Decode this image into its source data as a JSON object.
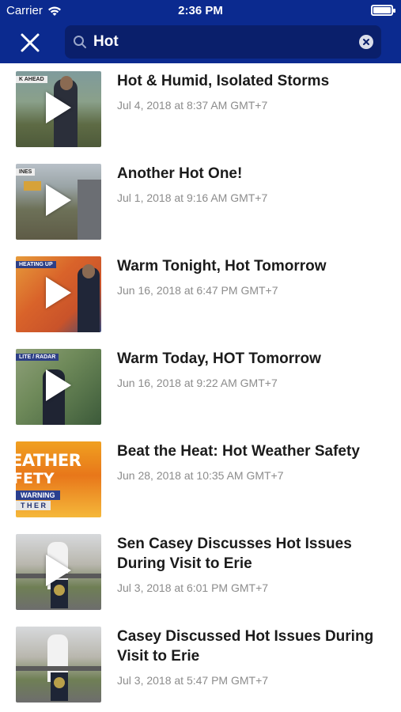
{
  "status_bar": {
    "carrier": "Carrier",
    "time": "2:36 PM"
  },
  "search": {
    "query": "Hot",
    "placeholder": ""
  },
  "results": [
    {
      "title": "Hot & Humid, Isolated Storms",
      "date": "Jul 4, 2018 at 8:37 AM GMT+7",
      "thumb_tag": "K AHEAD"
    },
    {
      "title": "Another Hot One!",
      "date": "Jul 1, 2018 at 9:16 AM GMT+7",
      "thumb_tag": "INES"
    },
    {
      "title": "Warm Tonight, Hot Tomorrow",
      "date": "Jun 16, 2018 at 6:47 PM GMT+7",
      "thumb_tag": "HEATING UP"
    },
    {
      "title": "Warm Today, HOT Tomorrow",
      "date": "Jun 16, 2018 at 9:22 AM GMT+7",
      "thumb_tag": "LITE / RADAR"
    },
    {
      "title": "Beat the Heat: Hot Weather Safety",
      "date": "Jun 28, 2018 at 10:35 AM GMT+7",
      "thumb_tag": ""
    },
    {
      "title": "Sen Casey Discusses Hot Issues During Visit to Erie",
      "date": "Jul 3, 2018 at 6:01 PM GMT+7",
      "thumb_tag": ""
    },
    {
      "title": "Casey Discussed Hot Issues During Visit to Erie",
      "date": "Jul 3, 2018 at 5:47 PM GMT+7",
      "thumb_tag": ""
    }
  ],
  "thumb_text": {
    "weather": "EATHER",
    "safety": "FETY",
    "warning": "WARNING",
    "other": "T H E R"
  },
  "colors": {
    "header": "#0b2a8f",
    "search_bg": "#0a1f6b",
    "date_text": "#8c8c8c"
  }
}
